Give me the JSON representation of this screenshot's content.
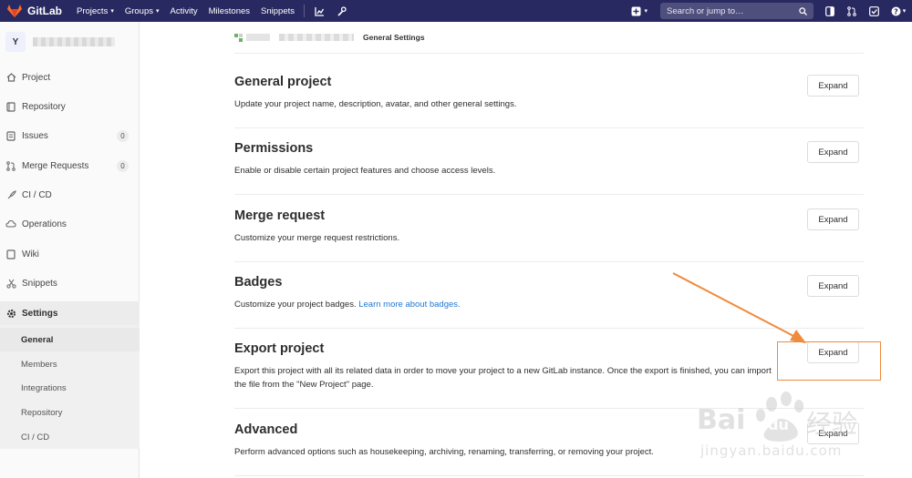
{
  "navbar": {
    "brand": "GitLab",
    "links": [
      "Projects",
      "Groups",
      "Activity",
      "Milestones",
      "Snippets"
    ],
    "search_placeholder": "Search or jump to…"
  },
  "sidebar": {
    "avatar_letter": "Y",
    "items": [
      {
        "label": "Project",
        "icon": "home-icon"
      },
      {
        "label": "Repository",
        "icon": "book-icon"
      },
      {
        "label": "Issues",
        "icon": "issues-icon",
        "badge": "0"
      },
      {
        "label": "Merge Requests",
        "icon": "merge-request-icon",
        "badge": "0"
      },
      {
        "label": "CI / CD",
        "icon": "rocket-icon"
      },
      {
        "label": "Operations",
        "icon": "cloud-gear-icon"
      },
      {
        "label": "Wiki",
        "icon": "wiki-icon"
      },
      {
        "label": "Snippets",
        "icon": "scissors-icon"
      },
      {
        "label": "Settings",
        "icon": "gear-icon"
      }
    ],
    "sub_items": [
      "General",
      "Members",
      "Integrations",
      "Repository",
      "CI / CD"
    ]
  },
  "breadcrumb": {
    "current": "General Settings"
  },
  "sections": [
    {
      "title": "General project",
      "desc": "Update your project name, description, avatar, and other general settings.",
      "button": "Expand"
    },
    {
      "title": "Permissions",
      "desc": "Enable or disable certain project features and choose access levels.",
      "button": "Expand"
    },
    {
      "title": "Merge request",
      "desc": "Customize your merge request restrictions.",
      "button": "Expand"
    },
    {
      "title": "Badges",
      "desc": "Customize your project badges.",
      "link": "Learn more about badges.",
      "button": "Expand"
    },
    {
      "title": "Export project",
      "desc": "Export this project with all its related data in order to move your project to a new GitLab instance. Once the export is finished, you can import the file from the \"New Project\" page.",
      "button": "Expand"
    },
    {
      "title": "Advanced",
      "desc": "Perform advanced options such as housekeeping, archiving, renaming, transferring, or removing your project.",
      "button": "Expand"
    }
  ],
  "watermark": {
    "brand": "Bai",
    "brand2": "du",
    "cn": "经验",
    "url": "jingyan.baidu.com"
  },
  "colors": {
    "navbar": "#292961",
    "accent_orange": "#f08a3c",
    "link": "#1f78d1"
  }
}
